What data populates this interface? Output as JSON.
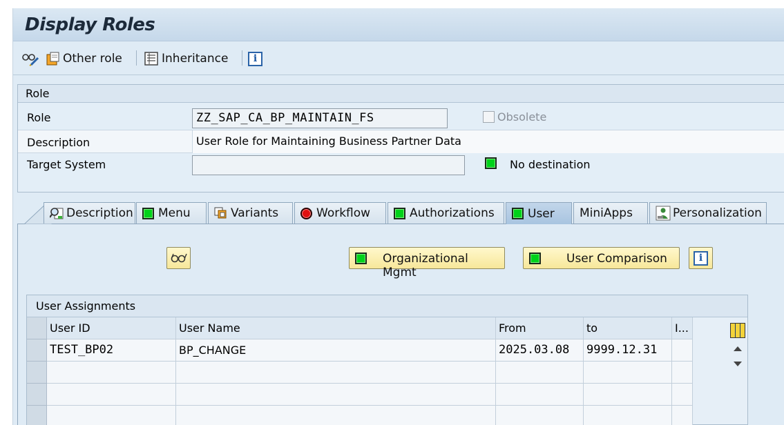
{
  "title": "Display Roles",
  "toolbar": {
    "other_role_label": "Other role",
    "inheritance_label": "Inheritance"
  },
  "role_section": {
    "header": "Role",
    "role_label": "Role",
    "role_value": "ZZ_SAP_CA_BP_MAINTAIN_FS",
    "obsolete_label": "Obsolete",
    "description_label": "Description",
    "description_value": "User Role for Maintaining Business Partner Data",
    "target_system_label": "Target System",
    "target_system_value": "",
    "destination_status": "No destination"
  },
  "tabs": [
    {
      "label": "Description",
      "status": "none"
    },
    {
      "label": "Menu",
      "status": "green"
    },
    {
      "label": "Variants",
      "status": "none"
    },
    {
      "label": "Workflow",
      "status": "red"
    },
    {
      "label": "Authorizations",
      "status": "green"
    },
    {
      "label": "User",
      "status": "green",
      "active": true
    },
    {
      "label": "MiniApps",
      "status": "none"
    },
    {
      "label": "Personalization",
      "status": "none"
    }
  ],
  "user_tab": {
    "org_mgmt_button": "Organizational Mgmt",
    "user_comparison_button": "User Comparison",
    "assignments": {
      "header": "User Assignments",
      "columns": [
        "User ID",
        "User Name",
        "From",
        "to",
        "I..."
      ],
      "rows": [
        [
          "TEST_BP02",
          "BP_CHANGE",
          "2025.03.08",
          "9999.12.31",
          ""
        ],
        [
          "",
          "",
          "",
          "",
          ""
        ],
        [
          "",
          "",
          "",
          "",
          ""
        ],
        [
          "",
          "",
          "",
          "",
          ""
        ]
      ]
    }
  },
  "colors": {
    "status_green": "#00d21a",
    "status_red": "#e01010",
    "button_yellow": "#f7e79a",
    "panel_blue": "#dfebf5"
  }
}
